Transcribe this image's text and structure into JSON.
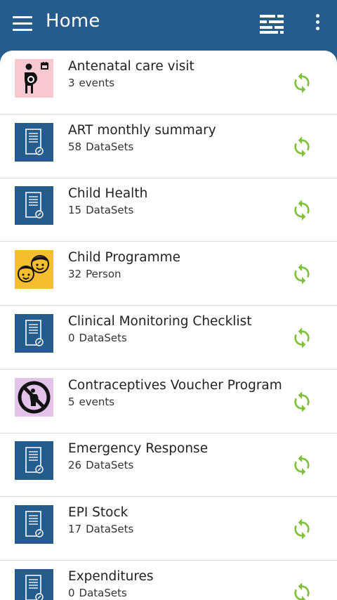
{
  "header": {
    "title": "Home",
    "menu_icon": "hamburger-menu-icon",
    "filter_icon": "filter-list-icon",
    "more_icon": "more-vertical-icon",
    "background_color": "#255c8c"
  },
  "sync_color": "#7cc336",
  "programs": [
    {
      "name": "Antenatal care visit",
      "count": "3",
      "unit": "events",
      "icon": "pregnant-woman-icon",
      "icon_bg": "#f8c9d0"
    },
    {
      "name": "ART monthly summary",
      "count": "58",
      "unit": "DataSets",
      "icon": "dataset-form-icon",
      "icon_bg": "#255c8c"
    },
    {
      "name": "Child Health",
      "count": "15",
      "unit": "DataSets",
      "icon": "dataset-form-icon",
      "icon_bg": "#255c8c"
    },
    {
      "name": "Child Programme",
      "count": "32",
      "unit": "Person",
      "icon": "children-faces-icon",
      "icon_bg": "#f6bd2e"
    },
    {
      "name": "Clinical Monitoring Checklist",
      "count": "0",
      "unit": "DataSets",
      "icon": "dataset-form-icon",
      "icon_bg": "#255c8c"
    },
    {
      "name": "Contraceptives Voucher Program",
      "count": "5",
      "unit": "events",
      "icon": "no-pregnancy-icon",
      "icon_bg": "#e3c3ea"
    },
    {
      "name": "Emergency Response",
      "count": "26",
      "unit": "DataSets",
      "icon": "dataset-form-icon",
      "icon_bg": "#255c8c"
    },
    {
      "name": "EPI Stock",
      "count": "17",
      "unit": "DataSets",
      "icon": "dataset-form-icon",
      "icon_bg": "#255c8c"
    },
    {
      "name": "Expenditures",
      "count": "0",
      "unit": "DataSets",
      "icon": "dataset-form-icon",
      "icon_bg": "#255c8c"
    }
  ]
}
